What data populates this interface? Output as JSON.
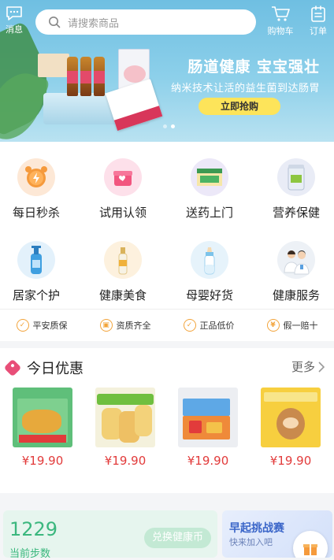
{
  "header": {
    "message_label": "消息",
    "search_placeholder": "请搜索商品",
    "cart_label": "购物车",
    "orders_label": "订单"
  },
  "banner": {
    "headline": "肠道健康 宝宝强壮",
    "subline": "纳米技术让活的益生菌到达肠胃",
    "cta_label": "立即抢购",
    "slide_count": 2,
    "active_slide": 2
  },
  "categories": [
    {
      "label": "每日秒杀",
      "icon": "alarm-clock-icon"
    },
    {
      "label": "试用认领",
      "icon": "gift-box-icon"
    },
    {
      "label": "送药上门",
      "icon": "medicine-box-icon"
    },
    {
      "label": "营养保健",
      "icon": "milk-powder-can-icon"
    },
    {
      "label": "居家个护",
      "icon": "shampoo-bottle-icon"
    },
    {
      "label": "健康美食",
      "icon": "drink-bottle-icon"
    },
    {
      "label": "母婴好货",
      "icon": "baby-bottle-icon"
    },
    {
      "label": "健康服务",
      "icon": "doctors-icon"
    }
  ],
  "guarantees": [
    {
      "label": "平安质保",
      "icon": "shield-icon"
    },
    {
      "label": "资质齐全",
      "icon": "certificate-icon"
    },
    {
      "label": "正品低价",
      "icon": "check-icon"
    },
    {
      "label": "假一赔十",
      "icon": "coin-icon"
    }
  ],
  "deals": {
    "title": "今日优惠",
    "more_label": "更多",
    "products": [
      {
        "price": "¥19.90",
        "image": "snack-box"
      },
      {
        "price": "¥19.90",
        "image": "corn-rolls"
      },
      {
        "price": "¥19.90",
        "image": "cake-pack"
      },
      {
        "price": "¥19.90",
        "image": "bear-cookies"
      }
    ]
  },
  "steps_card": {
    "count": "1229",
    "label": "当前步数",
    "exchange_label": "兑换健康币"
  },
  "challenge_card": {
    "title": "早起挑战赛",
    "subtitle": "快来加入吧"
  },
  "colors": {
    "accent_green": "#3bb77e",
    "price_red": "#e23b3b",
    "cta_yellow": "#fde45a",
    "guarantee_orange": "#f2a43b"
  }
}
